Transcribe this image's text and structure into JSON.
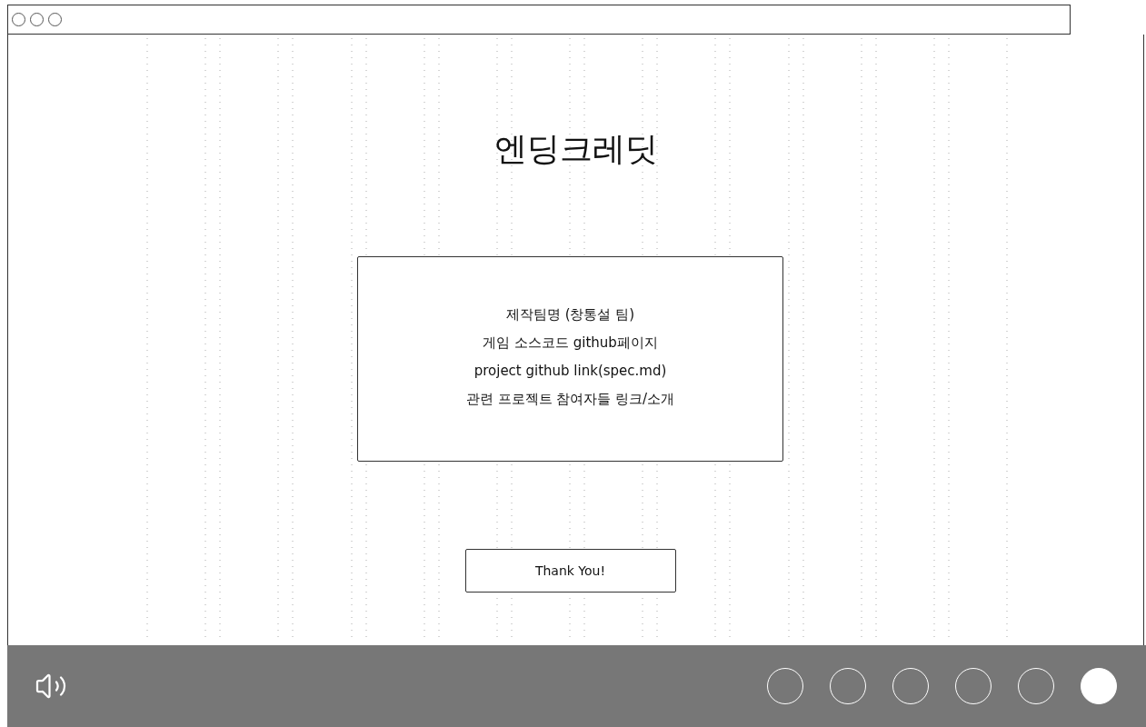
{
  "title": "엔딩크레딧",
  "credits": [
    "제작팀명 (창통설 팀)",
    "게임 소스코드 github페이지",
    "project github link(spec.md)",
    "관련 프로젝트 참여자들 링크/소개"
  ],
  "button": "Thank You!",
  "sound": {
    "on": true
  },
  "pages": [
    {
      "selected": false
    },
    {
      "selected": false
    },
    {
      "selected": false
    },
    {
      "selected": false
    },
    {
      "selected": false
    },
    {
      "selected": true
    }
  ]
}
